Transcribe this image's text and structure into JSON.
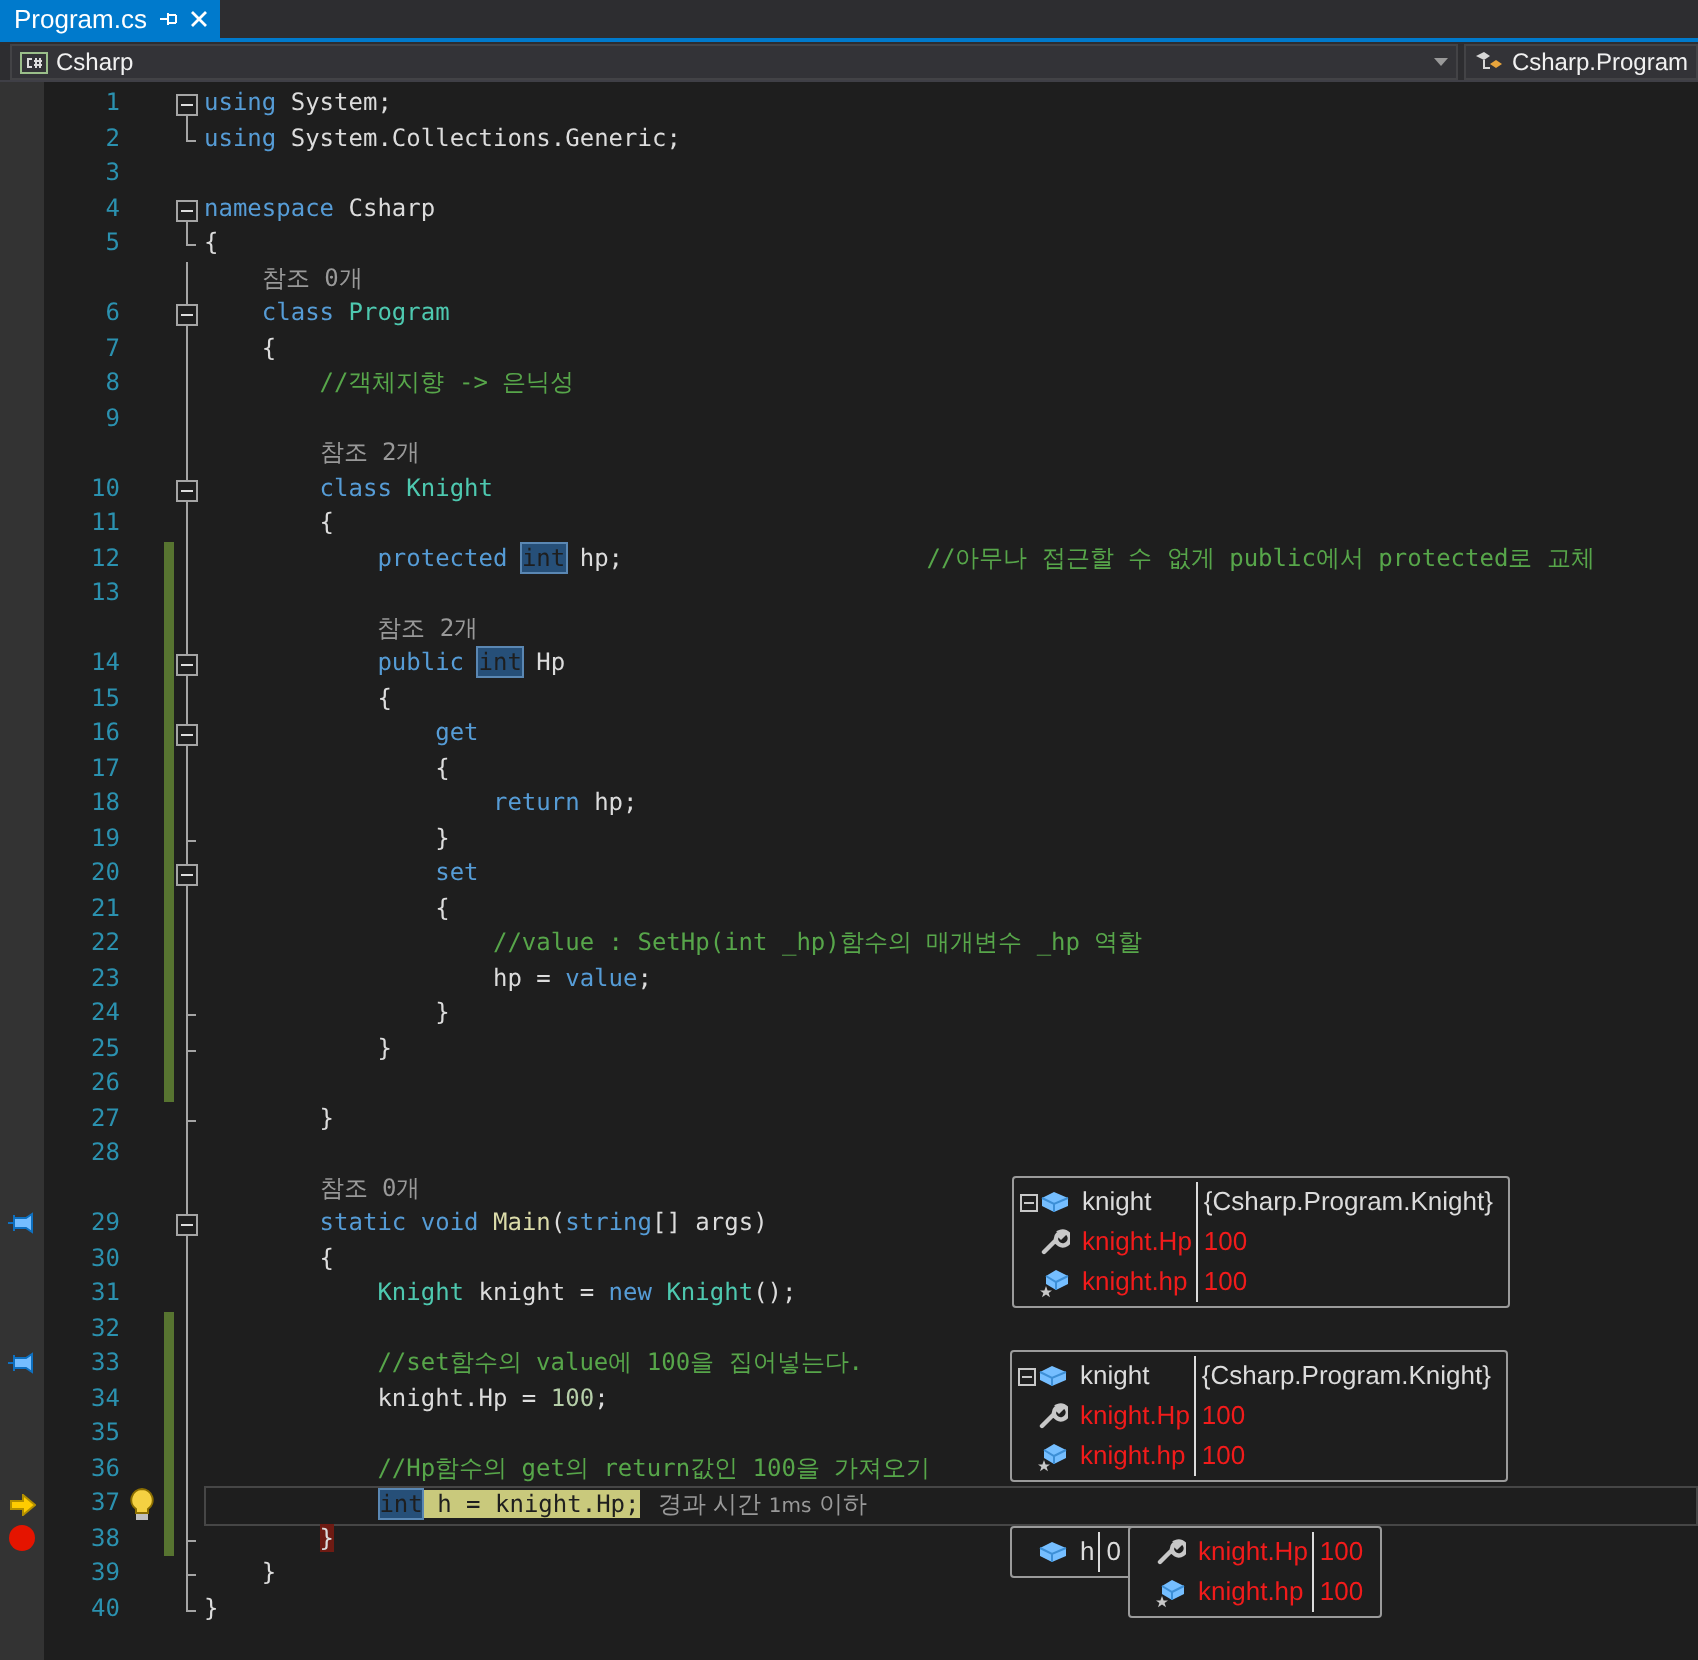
{
  "tabs": [
    {
      "label": "Program.cs",
      "selected": true
    }
  ],
  "navigation": {
    "project": "Csharp",
    "member": "Csharp.Program"
  },
  "editor": {
    "lines": [
      {
        "kind": "code",
        "number": "1",
        "expanded": true,
        "changed": false,
        "tokens": [
          {
            "kind": "kw",
            "text": "using"
          },
          {
            "kind": "plain",
            "text": " System;"
          }
        ]
      },
      {
        "kind": "code",
        "number": "2",
        "changed": false,
        "tokens": [
          {
            "kind": "kw",
            "text": "using"
          },
          {
            "kind": "plain",
            "text": " System.Collections.Generic;"
          }
        ]
      },
      {
        "kind": "code",
        "number": "3",
        "changed": false
      },
      {
        "kind": "code",
        "number": "4",
        "expanded": true,
        "changed": false,
        "tokens": [
          {
            "kind": "kw",
            "text": "namespace"
          },
          {
            "kind": "plain",
            "text": " Csharp"
          }
        ]
      },
      {
        "kind": "code",
        "number": "5",
        "changed": false,
        "tokens": [
          {
            "kind": "plain",
            "text": "{"
          }
        ]
      },
      {
        "kind": "lens",
        "changed": false,
        "tokens": [
          {
            "kind": "lens",
            "text": "참조 0개"
          }
        ]
      },
      {
        "kind": "code",
        "number": "6",
        "expanded": true,
        "changed": false,
        "tokens": [
          {
            "kind": "kw",
            "text": "class"
          },
          {
            "kind": "type",
            "text": " Program"
          }
        ]
      },
      {
        "kind": "code",
        "number": "7",
        "changed": false,
        "tokens": [
          {
            "kind": "plain",
            "text": "{"
          }
        ]
      },
      {
        "kind": "code",
        "number": "8",
        "changed": false,
        "tokens": [
          {
            "kind": "comment",
            "text": "//객체지향 -> 은닉성"
          }
        ]
      },
      {
        "kind": "code",
        "number": "9",
        "changed": false
      },
      {
        "kind": "lens",
        "changed": false,
        "tokens": [
          {
            "kind": "lens",
            "text": "참조 2개"
          }
        ]
      },
      {
        "kind": "code",
        "number": "10",
        "expanded": true,
        "changed": false,
        "tokens": [
          {
            "kind": "kw",
            "text": "class"
          },
          {
            "kind": "type",
            "text": " Knight"
          }
        ]
      },
      {
        "kind": "code",
        "number": "11",
        "changed": false,
        "tokens": [
          {
            "kind": "plain",
            "text": "{"
          }
        ]
      },
      {
        "kind": "code",
        "number": "12",
        "changed": true,
        "tokens": [
          {
            "kind": "kw",
            "text": "protected "
          },
          {
            "kind": "kw",
            "text": "int",
            "reference": true
          },
          {
            "kind": "plain",
            "text": " hp;                     "
          },
          {
            "kind": "comment",
            "text": "//아무나 접근할 수 없게 public에서 protected로 교체"
          }
        ]
      },
      {
        "kind": "code",
        "number": "13",
        "changed": true
      },
      {
        "kind": "lens",
        "changed": true,
        "tokens": [
          {
            "kind": "lens",
            "text": "참조 2개"
          }
        ]
      },
      {
        "kind": "code",
        "number": "14",
        "expanded": true,
        "changed": true,
        "tokens": [
          {
            "kind": "kw",
            "text": "public "
          },
          {
            "kind": "kw",
            "text": "int",
            "reference": true
          },
          {
            "kind": "plain",
            "text": " Hp"
          }
        ]
      },
      {
        "kind": "code",
        "number": "15",
        "changed": true,
        "tokens": [
          {
            "kind": "plain",
            "text": "{"
          }
        ]
      },
      {
        "kind": "code",
        "number": "16",
        "expanded": true,
        "changed": true,
        "tokens": [
          {
            "kind": "kw",
            "text": "get"
          }
        ]
      },
      {
        "kind": "code",
        "number": "17",
        "changed": true,
        "tokens": [
          {
            "kind": "plain",
            "text": "{"
          }
        ]
      },
      {
        "kind": "code",
        "number": "18",
        "changed": true,
        "tokens": [
          {
            "kind": "kw",
            "text": "return"
          },
          {
            "kind": "plain",
            "text": " hp;"
          }
        ]
      },
      {
        "kind": "code",
        "number": "19",
        "changed": true,
        "tokens": [
          {
            "kind": "plain",
            "text": "}"
          }
        ]
      },
      {
        "kind": "code",
        "number": "20",
        "expanded": true,
        "changed": true,
        "tokens": [
          {
            "kind": "kw",
            "text": "set"
          }
        ]
      },
      {
        "kind": "code",
        "number": "21",
        "changed": true,
        "tokens": [
          {
            "kind": "plain",
            "text": "{"
          }
        ]
      },
      {
        "kind": "code",
        "number": "22",
        "changed": true,
        "tokens": [
          {
            "kind": "comment",
            "text": "//value : SetHp(int _hp)함수의 매개변수 _hp 역할"
          }
        ]
      },
      {
        "kind": "code",
        "number": "23",
        "changed": true,
        "tokens": [
          {
            "kind": "plain",
            "text": "hp = "
          },
          {
            "kind": "kw",
            "text": "value"
          },
          {
            "kind": "plain",
            "text": ";"
          }
        ]
      },
      {
        "kind": "code",
        "number": "24",
        "changed": true,
        "tokens": [
          {
            "kind": "plain",
            "text": "}"
          }
        ]
      },
      {
        "kind": "code",
        "number": "25",
        "changed": true,
        "tokens": [
          {
            "kind": "plain",
            "text": "}"
          }
        ]
      },
      {
        "kind": "code",
        "number": "26",
        "changed": true
      },
      {
        "kind": "code",
        "number": "27",
        "changed": false,
        "tokens": [
          {
            "kind": "plain",
            "text": "}"
          }
        ]
      },
      {
        "kind": "code",
        "number": "28",
        "changed": false
      },
      {
        "kind": "lens",
        "changed": false,
        "tokens": [
          {
            "kind": "lens",
            "text": "참조 0개"
          }
        ]
      },
      {
        "kind": "code",
        "number": "29",
        "expanded": true,
        "pinned": true,
        "changed": false,
        "tokens": [
          {
            "kind": "kw",
            "text": "static void "
          },
          {
            "kind": "method",
            "text": "Main"
          },
          {
            "kind": "plain",
            "text": "("
          },
          {
            "kind": "kw",
            "text": "string"
          },
          {
            "kind": "plain",
            "text": "[] args)"
          }
        ]
      },
      {
        "kind": "code",
        "number": "30",
        "changed": false,
        "tokens": [
          {
            "kind": "plain",
            "text": "{"
          }
        ]
      },
      {
        "kind": "code",
        "number": "31",
        "changed": false,
        "tokens": [
          {
            "kind": "type",
            "text": "Knight"
          },
          {
            "kind": "plain",
            "text": " knight = "
          },
          {
            "kind": "kw",
            "text": "new "
          },
          {
            "kind": "type",
            "text": "Knight"
          },
          {
            "kind": "plain",
            "text": "();"
          }
        ]
      },
      {
        "kind": "code",
        "number": "32",
        "changed": true
      },
      {
        "kind": "code",
        "number": "33",
        "pinned": true,
        "changed": true,
        "tokens": [
          {
            "kind": "comment",
            "text": "//set함수의 value에 100을 집어넣는다."
          }
        ]
      },
      {
        "kind": "code",
        "number": "34",
        "changed": true,
        "tokens": [
          {
            "kind": "plain",
            "text": "knight.Hp = "
          },
          {
            "kind": "num",
            "text": "100"
          },
          {
            "kind": "plain",
            "text": ";"
          }
        ]
      },
      {
        "kind": "code",
        "number": "35",
        "changed": true
      },
      {
        "kind": "code",
        "number": "36",
        "changed": true,
        "tokens": [
          {
            "kind": "comment",
            "text": "//Hp함수의 get의 return값인 100을 가져오기"
          }
        ]
      },
      {
        "kind": "code",
        "number": "37",
        "next_statement": true,
        "lightbulb": true,
        "current": true,
        "changed": true,
        "tokens": [
          {
            "kind": "kw",
            "text": "int",
            "reference": true
          },
          {
            "kind": "plain",
            "text": " h = knight.Hp;"
          }
        ],
        "hint": {
          "label": "경과 시간",
          "value": "1ms",
          "suffix": "이하"
        }
      },
      {
        "kind": "code",
        "number": "38",
        "breakpoint": true,
        "changed": true,
        "tokens": [
          {
            "kind": "plain",
            "text": "}"
          }
        ]
      },
      {
        "kind": "code",
        "number": "39",
        "changed": false,
        "tokens": [
          {
            "kind": "plain",
            "text": "}"
          }
        ]
      },
      {
        "kind": "code",
        "number": "40",
        "changed": false,
        "tokens": [
          {
            "kind": "plain",
            "text": "}"
          }
        ]
      }
    ]
  },
  "datatips": [
    {
      "rows": [
        {
          "kind": "object",
          "expanded": true,
          "name": "knight",
          "value": "{Csharp.Program.Knight}",
          "changed": false
        },
        {
          "kind": "property",
          "name": "knight.Hp",
          "value": "100",
          "changed": true
        },
        {
          "kind": "field",
          "name": "knight.hp",
          "value": "100",
          "changed": true
        }
      ]
    },
    {
      "rows": [
        {
          "kind": "object",
          "expanded": true,
          "name": "knight",
          "value": "{Csharp.Program.Knight}",
          "changed": false
        },
        {
          "kind": "property",
          "name": "knight.Hp",
          "value": "100",
          "changed": true
        },
        {
          "kind": "field",
          "name": "knight.hp",
          "value": "100",
          "changed": true
        }
      ]
    },
    {
      "rows": [
        {
          "kind": "object",
          "name": "h",
          "value": "0",
          "changed": false
        }
      ]
    },
    {
      "rows": [
        {
          "kind": "property",
          "name": "knight.Hp",
          "value": "100",
          "changed": true
        },
        {
          "kind": "field",
          "name": "knight.hp",
          "value": "100",
          "changed": true
        }
      ]
    }
  ]
}
